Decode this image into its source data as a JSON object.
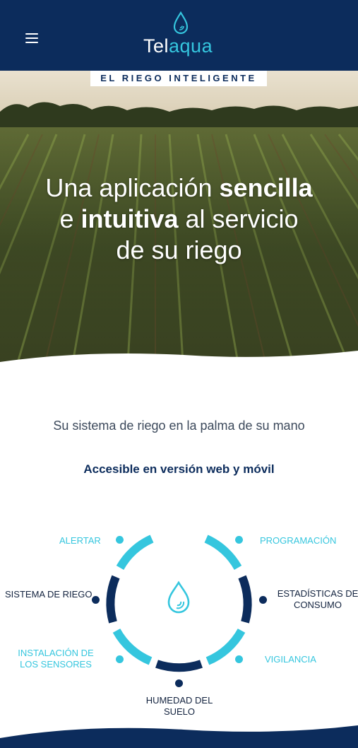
{
  "header": {
    "logo": {
      "part1": "Tel",
      "part2": "aqua"
    },
    "colors": {
      "background": "#0c2c5c",
      "accent": "#35c6de"
    }
  },
  "hero": {
    "tagline": "EL RIEGO INTELIGENTE",
    "title_line1_a": "Una aplicación ",
    "title_line1_b": "sencilla",
    "title_line2_a": "e ",
    "title_line2_b": "intuitiva",
    "title_line2_c": " al servicio",
    "title_line3": "de su riego"
  },
  "section": {
    "subtitle": "Su sistema de riego en la palma de su mano",
    "accessible": "Accesible en versión web y móvil"
  },
  "features": {
    "alertar": "ALERTAR",
    "programacion": "PROGRAMACIÓN",
    "sistema_line1": "SISTEMA DE RIEGO",
    "estadisticas_line1": "ESTADÍSTICAS DE",
    "estadisticas_line2": "CONSUMO",
    "instalacion_line1": "INSTALACIÓN DE",
    "instalacion_line2": "LOS SENSORES",
    "vigilancia": "VIGILANCIA",
    "humedad_line1": "HUMEDAD DEL",
    "humedad_line2": "SUELO"
  }
}
